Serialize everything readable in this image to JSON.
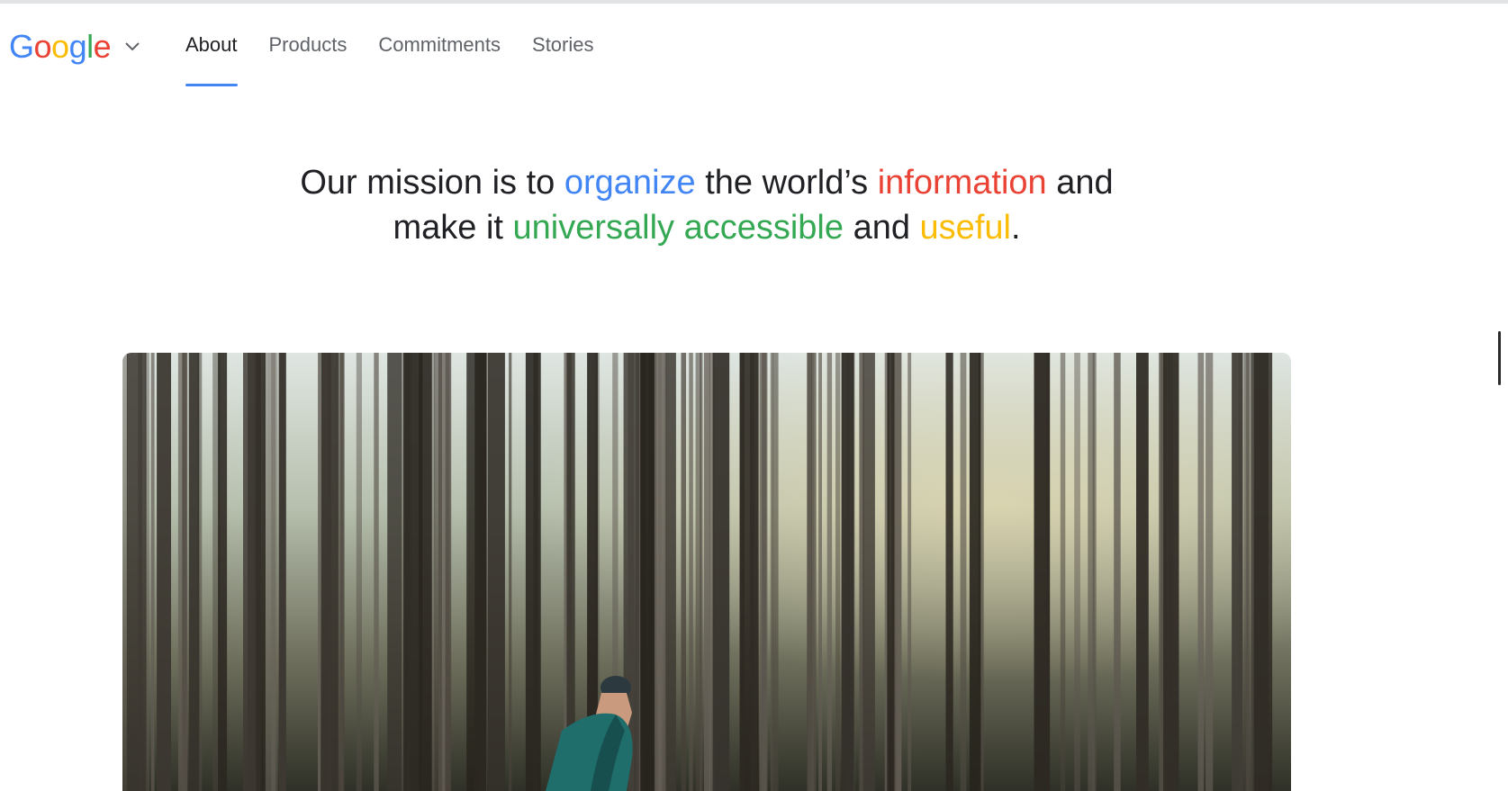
{
  "logo": {
    "letters": [
      {
        "char": "G",
        "color": "#4285F4"
      },
      {
        "char": "o",
        "color": "#EA4335"
      },
      {
        "char": "o",
        "color": "#FBBC05"
      },
      {
        "char": "g",
        "color": "#4285F4"
      },
      {
        "char": "l",
        "color": "#34A853"
      },
      {
        "char": "e",
        "color": "#EA4335"
      }
    ],
    "menu_icon": "chevron-down-icon"
  },
  "nav": {
    "items": [
      {
        "label": "About",
        "active": true
      },
      {
        "label": "Products",
        "active": false
      },
      {
        "label": "Commitments",
        "active": false
      },
      {
        "label": "Stories",
        "active": false
      }
    ],
    "active_color": "#4285F4"
  },
  "mission": {
    "line1": [
      {
        "text": "Our mission is to ",
        "color": "#202124"
      },
      {
        "text": "organize",
        "color": "#4285F4"
      },
      {
        "text": " the world’s ",
        "color": "#202124"
      },
      {
        "text": "information",
        "color": "#EA4335"
      },
      {
        "text": " and",
        "color": "#202124"
      }
    ],
    "line2": [
      {
        "text": "make it ",
        "color": "#202124"
      },
      {
        "text": "universally accessible",
        "color": "#34A853"
      },
      {
        "text": " and ",
        "color": "#202124"
      },
      {
        "text": "useful",
        "color": "#FBBC05"
      },
      {
        "text": ".",
        "color": "#202124"
      }
    ]
  },
  "hero": {
    "image_subject": "cyclist riding through a pine forest"
  }
}
